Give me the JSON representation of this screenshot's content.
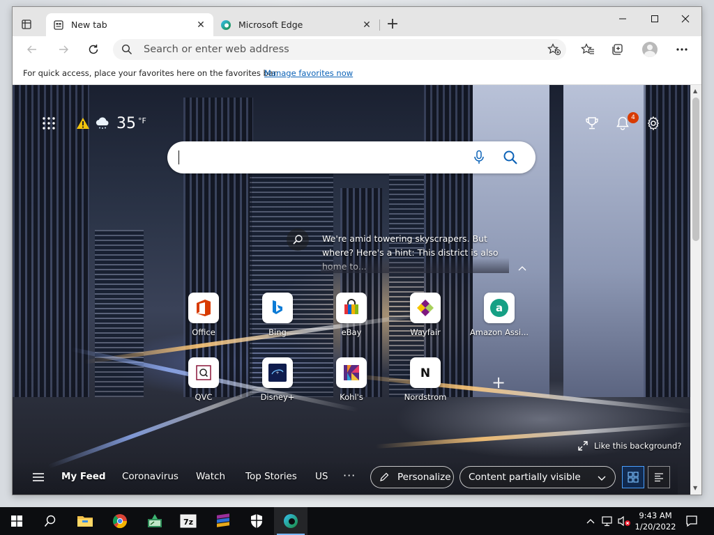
{
  "browser": {
    "tabs": [
      {
        "title": "New tab",
        "active": true
      },
      {
        "title": "Microsoft Edge",
        "active": false
      }
    ],
    "address": {
      "placeholder": "Search or enter web address",
      "value": ""
    },
    "favorites_bar": {
      "message": "For quick access, place your favorites here on the favorites bar.",
      "link": "Manage favorites now"
    }
  },
  "new_tab": {
    "weather": {
      "temperature": "35",
      "unit": "°F"
    },
    "notification_count": "4",
    "search": {
      "placeholder": ""
    },
    "background_hint": "We're amid towering skyscrapers. But where? Here's a hint: This district is also home to...",
    "quick_links": [
      {
        "label": "Office",
        "icon": "office-icon"
      },
      {
        "label": "Bing",
        "icon": "bing-icon"
      },
      {
        "label": "eBay",
        "icon": "ebay-icon"
      },
      {
        "label": "Wayfair",
        "icon": "wayfair-icon"
      },
      {
        "label": "Amazon Assi...",
        "icon": "amazon-icon"
      },
      {
        "label": "QVC",
        "icon": "qvc-icon"
      },
      {
        "label": "Disney+",
        "icon": "disney-icon"
      },
      {
        "label": "Kohl's",
        "icon": "kohls-icon"
      },
      {
        "label": "Nordstrom",
        "icon": "nordstrom-icon"
      }
    ],
    "like_background": "Like this background?",
    "feed": {
      "tabs": [
        "My Feed",
        "Coronavirus",
        "Watch",
        "Top Stories",
        "US"
      ],
      "more": "···",
      "personalize": "Personalize",
      "visibility": "Content partially visible"
    }
  },
  "taskbar": {
    "time": "9:43 AM",
    "date": "1/20/2022"
  },
  "colors": {
    "accent": "#0b62b7",
    "badge": "#d83b01",
    "taskbar": "#0c0d10"
  }
}
